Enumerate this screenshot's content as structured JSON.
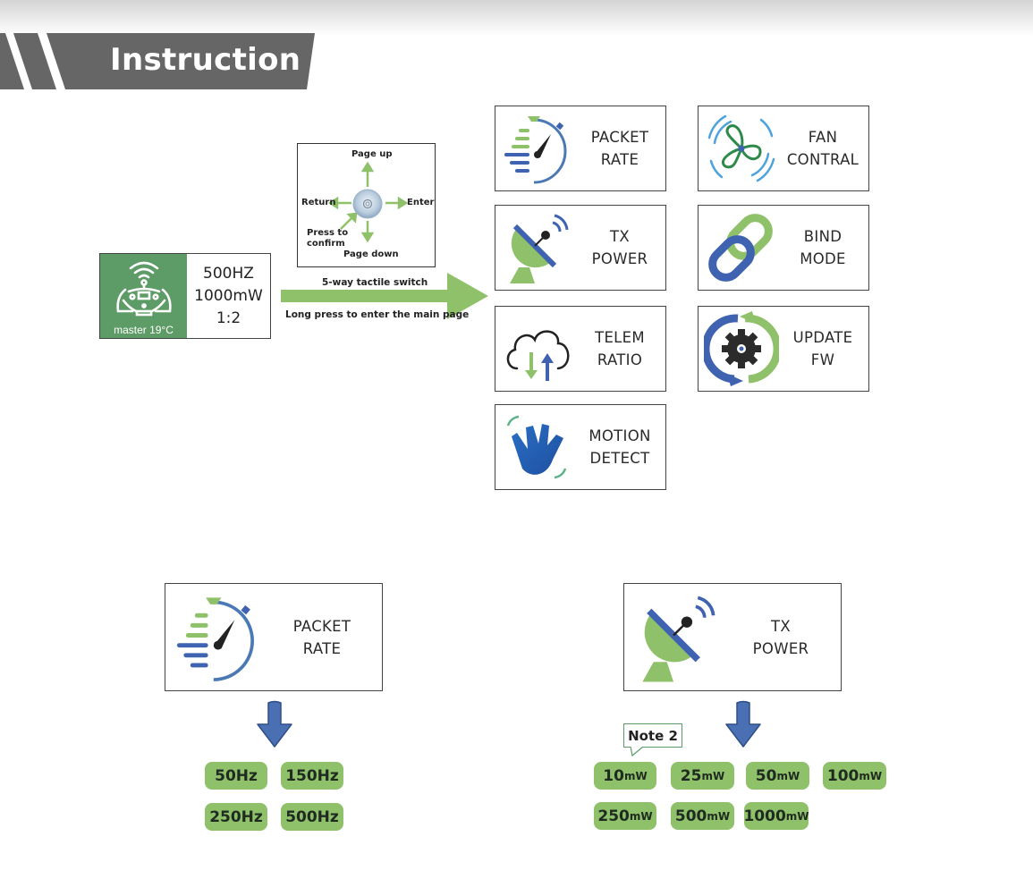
{
  "header": {
    "title": "Instruction"
  },
  "status_screen": {
    "footer": "master  19°C",
    "lines": [
      "500HZ",
      "1000mW",
      "1:2"
    ]
  },
  "joystick": {
    "up": "Page up",
    "down": "Page down",
    "left": "Return",
    "right": "Enter",
    "press_line1": "Press to",
    "press_line2": "confirm"
  },
  "transition": {
    "top_label": "5-way tactile switch",
    "bottom_label": "Long press to enter the main page"
  },
  "menu": [
    {
      "id": "packet-rate",
      "line1": "PACKET",
      "line2": "RATE",
      "icon": "stopwatch-icon"
    },
    {
      "id": "tx-power",
      "line1": "TX",
      "line2": "POWER",
      "icon": "satellite-dish-icon"
    },
    {
      "id": "telem-ratio",
      "line1": "TELEM",
      "line2": "RATIO",
      "icon": "cloud-transfer-icon"
    },
    {
      "id": "motion-detect",
      "line1": "MOTION",
      "line2": "DETECT",
      "icon": "waving-hand-icon"
    },
    {
      "id": "fan-control",
      "line1": "FAN",
      "line2": "CONTRAL",
      "icon": "fan-icon"
    },
    {
      "id": "bind-mode",
      "line1": "BIND",
      "line2": "MODE",
      "icon": "link-icon"
    },
    {
      "id": "update-fw",
      "line1": "UPDATE",
      "line2": "FW",
      "icon": "gear-sync-icon"
    }
  ],
  "packet_rate_detail": {
    "line1": "PACKET",
    "line2": "RATE",
    "options": [
      "50Hz",
      "150Hz",
      "250Hz",
      "500Hz"
    ]
  },
  "tx_power_detail": {
    "line1": "TX",
    "line2": "POWER",
    "note": "Note 2",
    "unit": "mW",
    "options": [
      "10",
      "25",
      "50",
      "100",
      "250",
      "500",
      "1000"
    ]
  },
  "colors": {
    "green": "#8fc16a",
    "dark_green": "#5e9c67",
    "blue": "#3f63b0",
    "banner_gray": "#666666"
  }
}
